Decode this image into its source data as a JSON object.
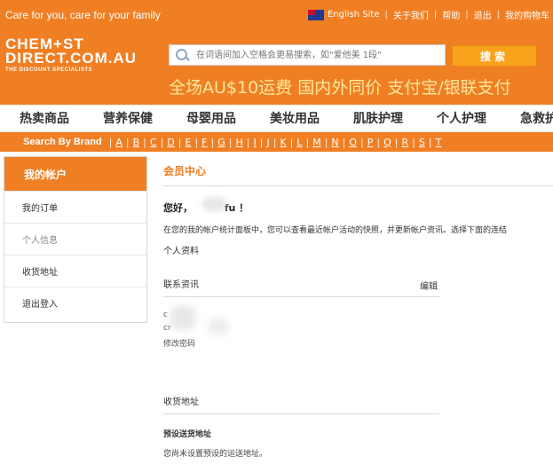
{
  "header": {
    "tagline": "Care for you, care for your family",
    "top_links": [
      "English Site",
      "关于我们",
      "帮助",
      "退出",
      "我的购物车"
    ],
    "logo": {
      "line1": "CHEM+ST",
      "line2": "DIRECT.COM.AU",
      "line3": "THE DISCOUNT SPECIALISTS"
    },
    "search": {
      "placeholder": "在词语间加入空格会更易搜索，如\"爱他美 1段\"",
      "button": "搜索"
    },
    "promo": "全场AU$10运费  国内外同价  支付宝/银联支付"
  },
  "categories": [
    "热卖商品",
    "营养保健",
    "母婴用品",
    "美妆用品",
    "肌肤护理",
    "个人护理",
    "急救护"
  ],
  "brand_bar": {
    "label": "Search By Brand",
    "letters": [
      "A",
      "B",
      "C",
      "D",
      "E",
      "F",
      "G",
      "H",
      "I",
      "J",
      "K",
      "L",
      "M",
      "N",
      "O",
      "P",
      "Q",
      "R",
      "S",
      "T"
    ]
  },
  "sidebar": {
    "title": "我的帐户",
    "items": [
      "我的订单",
      "个人信息",
      "收货地址",
      "退出登入"
    ]
  },
  "main": {
    "title": "会员中心",
    "greeting": "您好，",
    "greeting_name": "fu",
    "greeting_end": "！",
    "intro": "在您的我的帐户统计面板中，您可以查看最近帐户活动的快照，并更新帐户资讯。选择下面的连结",
    "profile": "个人资料",
    "contact_heading": "联系资讯",
    "edit": "编辑",
    "contact_line1": "c",
    "contact_line2": "cr",
    "change_password": "修改密码",
    "address_heading": "收货地址",
    "default_address": "预设送货地址",
    "no_address": "您尚未设置预设的运送地址。"
  }
}
